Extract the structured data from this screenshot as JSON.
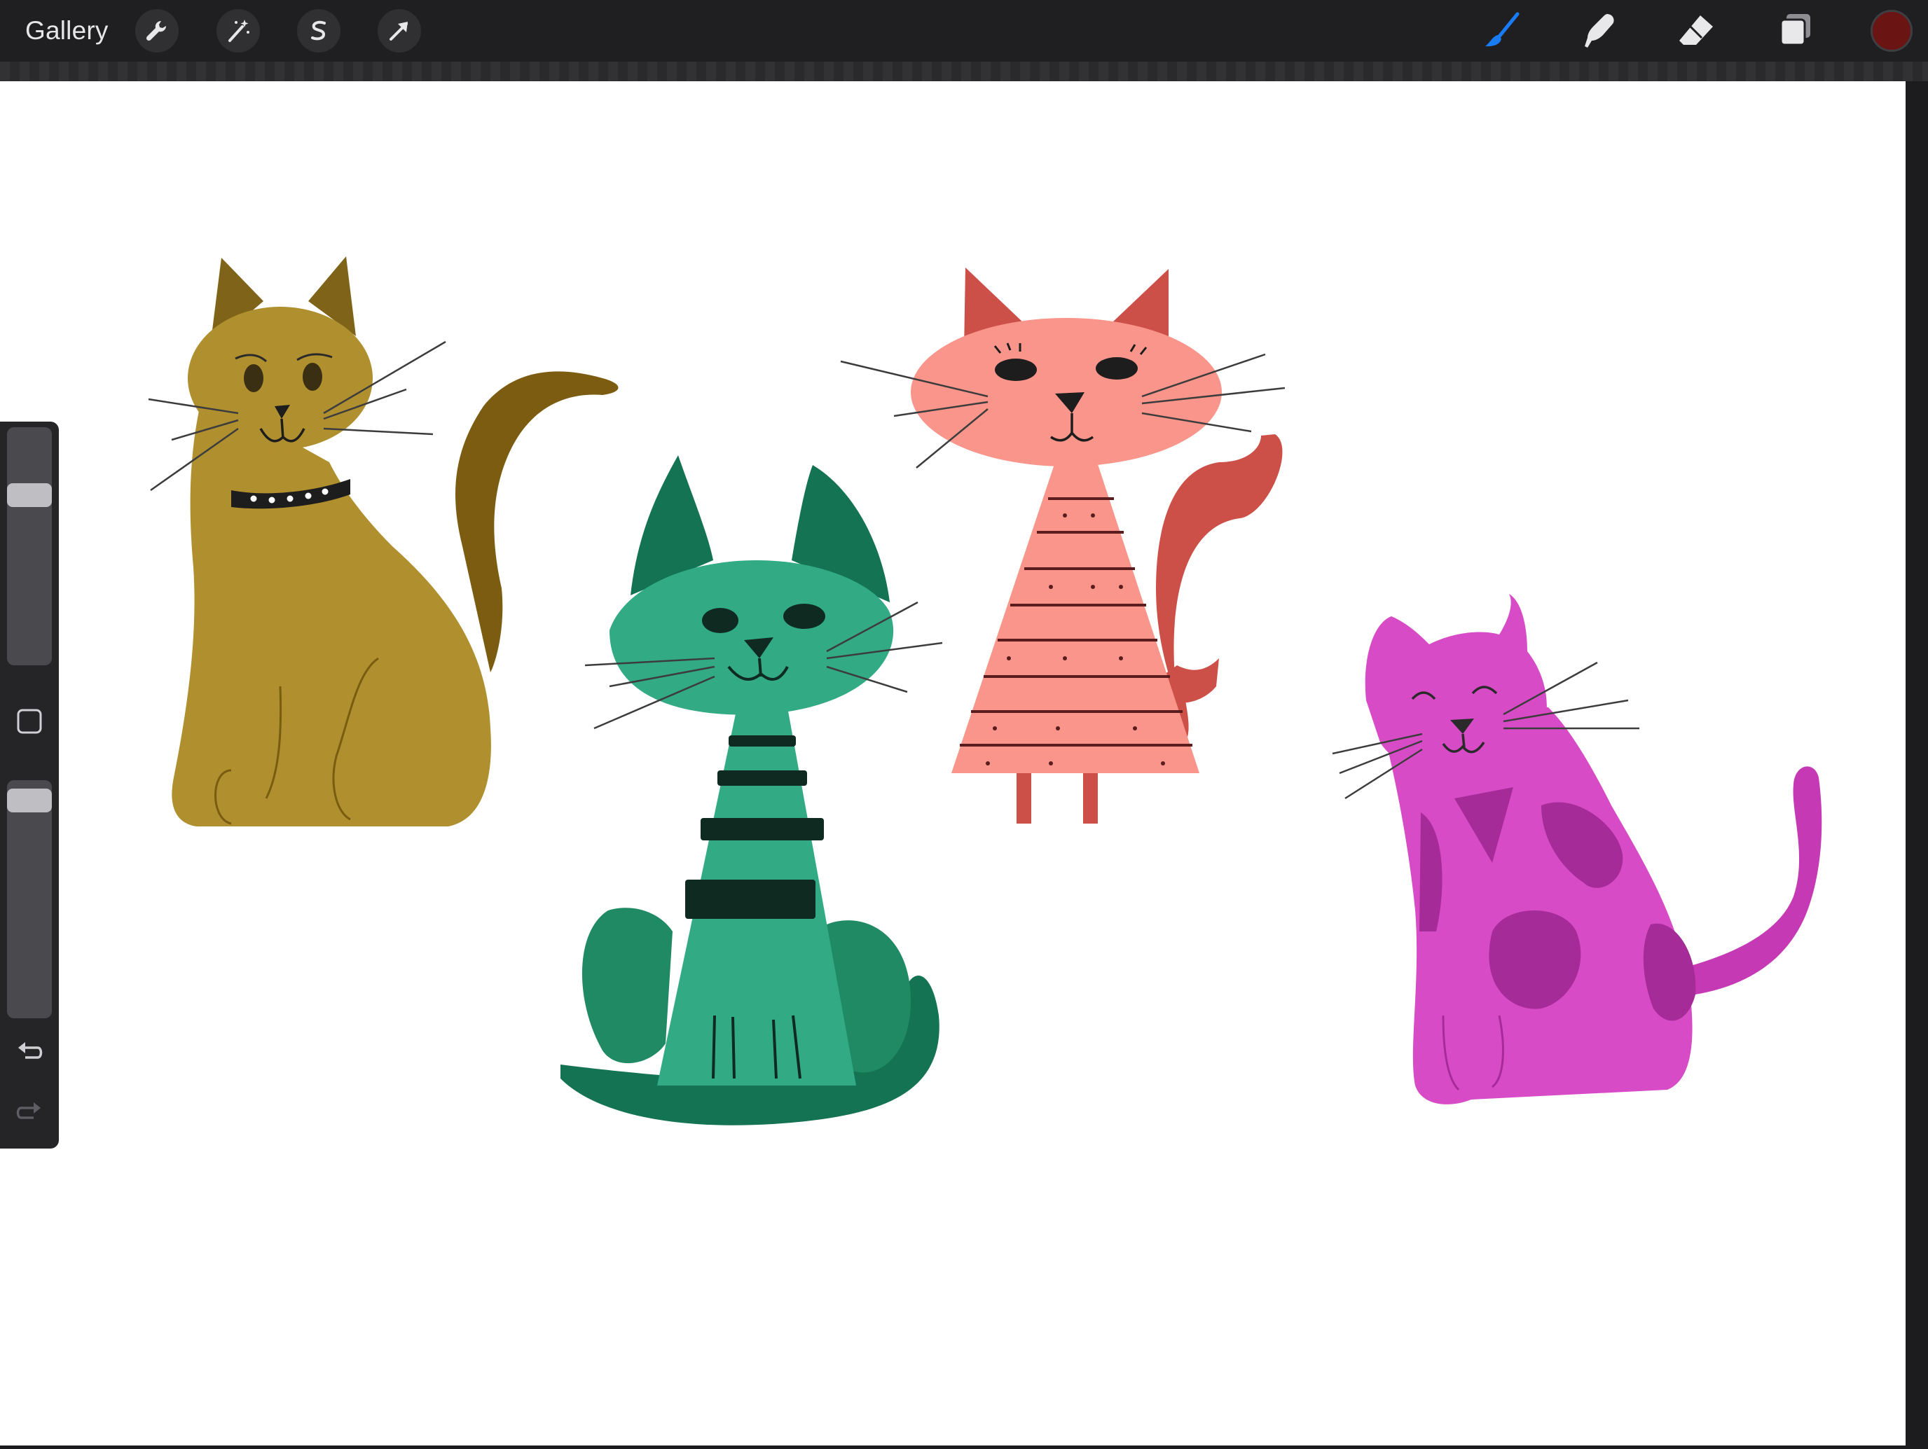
{
  "topbar": {
    "gallery_label": "Gallery",
    "left_tools": [
      {
        "name": "actions",
        "icon": "wrench-icon"
      },
      {
        "name": "adjustments",
        "icon": "magic-wand-icon"
      },
      {
        "name": "selection",
        "icon": "selection-s-icon"
      },
      {
        "name": "transform",
        "icon": "arrow-cursor-icon"
      }
    ],
    "right_tools": [
      {
        "name": "brush",
        "icon": "brush-icon",
        "active": true
      },
      {
        "name": "smudge",
        "icon": "smudge-finger-icon"
      },
      {
        "name": "eraser",
        "icon": "eraser-icon"
      },
      {
        "name": "layers",
        "icon": "layers-icon"
      }
    ],
    "current_color": "#6b1414",
    "active_tool_color": "#1a7cf5"
  },
  "sidebar": {
    "brush_size_level": 0.74,
    "opacity_level": 0.96,
    "buttons": [
      "modify-square-icon",
      "undo-icon",
      "redo-icon"
    ]
  },
  "canvas": {
    "background": "#ffffff",
    "cats": [
      {
        "name": "mustard-cat",
        "body_color": "#b08f2f",
        "detail_color": "#7a5c10",
        "has_collar": true
      },
      {
        "name": "green-cat",
        "body_color": "#32ab84",
        "detail_color": "#137352",
        "has_stripes": true
      },
      {
        "name": "coral-cat",
        "body_color": "#f9958a",
        "detail_color": "#cd5048",
        "has_stripes": true
      },
      {
        "name": "magenta-cat",
        "body_color": "#d84bc6",
        "detail_color": "#a52b98",
        "has_spots": true
      }
    ]
  }
}
